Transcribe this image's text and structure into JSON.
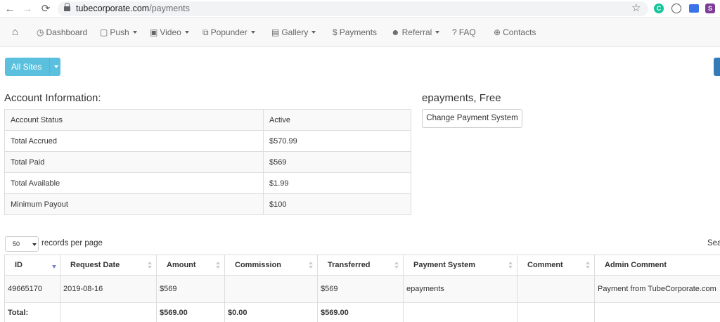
{
  "browser": {
    "back_icon": "←",
    "forward_icon": "→",
    "reload_icon": "⟳",
    "url_domain": "tubecorporate.com",
    "url_path": "/payments",
    "star_icon": "☆",
    "ext_grammarly": "C",
    "ext_s": "S"
  },
  "nav": {
    "items": [
      {
        "label": "Dashboard"
      },
      {
        "label": "Push"
      },
      {
        "label": "Video"
      },
      {
        "label": "Popunder"
      },
      {
        "label": "Gallery"
      },
      {
        "label": "Payments"
      },
      {
        "label": "Referral"
      },
      {
        "label": "FAQ"
      },
      {
        "label": "Contacts"
      }
    ],
    "icons": {
      "home": "⌂",
      "dashboard": "◷",
      "push": "▢",
      "video": "▣",
      "popunder": "⧉",
      "gallery": "▤",
      "payments": "$",
      "referral": "☻",
      "faq": "?",
      "contacts": "⊕"
    }
  },
  "sites_button": {
    "label": "All Sites"
  },
  "account": {
    "title": "Account Information:",
    "rows": [
      {
        "label": "Account Status",
        "value": "Active"
      },
      {
        "label": "Total Accrued",
        "value": "$570.99"
      },
      {
        "label": "Total Paid",
        "value": "$569"
      },
      {
        "label": "Total Available",
        "value": "$1.99"
      },
      {
        "label": "Minimum Payout",
        "value": "$100"
      }
    ]
  },
  "payment_system": {
    "title": "epayments, Free",
    "change_label": "Change Payment System"
  },
  "pagination": {
    "page_size": "50",
    "label": "records per page",
    "search_label": "Sea"
  },
  "payments_table": {
    "headers": [
      "ID",
      "Request Date",
      "Amount",
      "Commission",
      "Transferred",
      "Payment System",
      "Comment",
      "Admin Comment"
    ],
    "rows": [
      {
        "id": "49665170",
        "request_date": "2019-08-16",
        "amount": "$569",
        "commission": "",
        "transferred": "$569",
        "payment_system": "epayments",
        "comment": "",
        "admin_comment": "Payment from TubeCorporate.com"
      }
    ],
    "totals": {
      "label": "Total:",
      "amount": "$569.00",
      "commission": "$0.00",
      "transferred": "$569.00"
    }
  }
}
